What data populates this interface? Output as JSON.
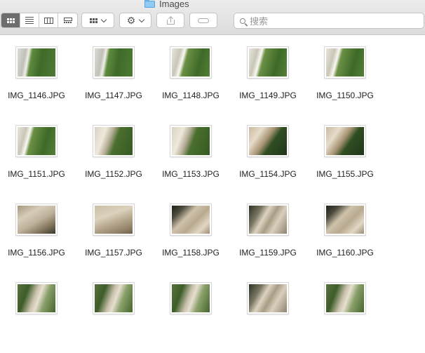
{
  "window": {
    "title": "Images"
  },
  "search": {
    "placeholder": "搜索"
  },
  "files": [
    {
      "name": "IMG_1146.JPG",
      "style": "p-a"
    },
    {
      "name": "IMG_1147.JPG",
      "style": "p-a"
    },
    {
      "name": "IMG_1148.JPG",
      "style": "p-b"
    },
    {
      "name": "IMG_1149.JPG",
      "style": "p-b"
    },
    {
      "name": "IMG_1150.JPG",
      "style": "p-b"
    },
    {
      "name": "IMG_1151.JPG",
      "style": "p-b"
    },
    {
      "name": "IMG_1152.JPG",
      "style": "p-c"
    },
    {
      "name": "IMG_1153.JPG",
      "style": "p-c"
    },
    {
      "name": "IMG_1154.JPG",
      "style": "p-d"
    },
    {
      "name": "IMG_1155.JPG",
      "style": "p-d"
    },
    {
      "name": "IMG_1156.JPG",
      "style": "p-e"
    },
    {
      "name": "IMG_1157.JPG",
      "style": "p-f"
    },
    {
      "name": "IMG_1158.JPG",
      "style": "p-g"
    },
    {
      "name": "IMG_1159.JPG",
      "style": "p-h"
    },
    {
      "name": "IMG_1160.JPG",
      "style": "p-g"
    },
    {
      "name": "",
      "style": "p-i"
    },
    {
      "name": "",
      "style": "p-i"
    },
    {
      "name": "",
      "style": "p-i"
    },
    {
      "name": "",
      "style": "p-h"
    },
    {
      "name": "",
      "style": "p-i"
    }
  ]
}
